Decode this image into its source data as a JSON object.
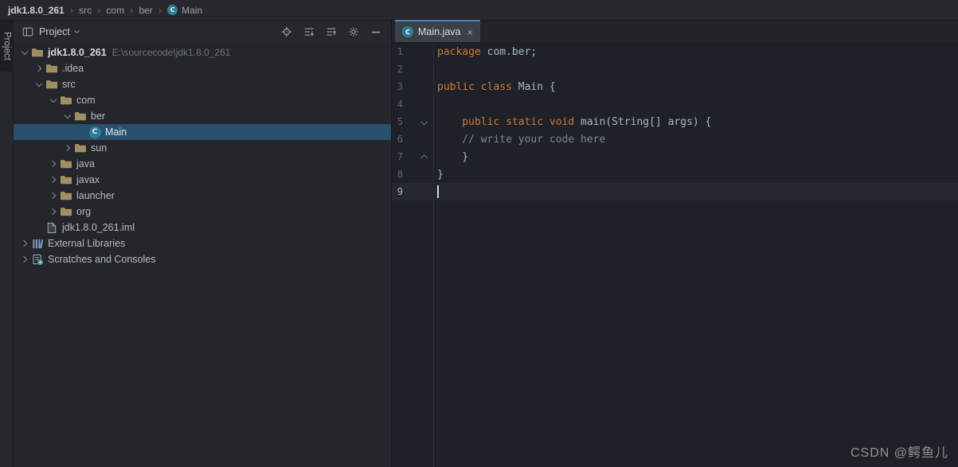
{
  "breadcrumbs": {
    "project": "jdk1.8.0_261",
    "sep": "›",
    "items": [
      "src",
      "com",
      "ber"
    ],
    "class_name": "Main"
  },
  "stripe": {
    "label": "Project"
  },
  "panel": {
    "title": "Project",
    "icons": [
      "locate-file-icon",
      "expand-all-icon",
      "collapse-all-icon",
      "settings-icon",
      "hide-icon"
    ]
  },
  "tree": {
    "items": [
      {
        "label": "jdk1.8.0_261",
        "path": "E:\\sourcecode\\jdk1.8.0_261"
      },
      {
        "label": ".idea"
      },
      {
        "label": "src"
      },
      {
        "label": "com"
      },
      {
        "label": "ber"
      },
      {
        "label": "Main"
      },
      {
        "label": "sun"
      },
      {
        "label": "java"
      },
      {
        "label": "javax"
      },
      {
        "label": "launcher"
      },
      {
        "label": "org"
      },
      {
        "label": "jdk1.8.0_261.iml"
      },
      {
        "label": "External Libraries"
      },
      {
        "label": "Scratches and Consoles"
      }
    ]
  },
  "tab": {
    "label": "Main.java",
    "close": "×"
  },
  "editor": {
    "lines": [
      {
        "num": "1",
        "segments": {
          "kw": "package",
          "pl": " com.ber;"
        }
      },
      {
        "num": "2"
      },
      {
        "num": "3",
        "segments": {
          "kw": "public class",
          "pl": " Main {"
        }
      },
      {
        "num": "4"
      },
      {
        "num": "5",
        "segments": {
          "kw": "    public static void",
          "pl": " main(String[] args) {"
        }
      },
      {
        "num": "6",
        "segments": {
          "cm": "    // write your code here"
        }
      },
      {
        "num": "7",
        "segments": {
          "pl": "    }"
        }
      },
      {
        "num": "8",
        "segments": {
          "pl": "}"
        }
      },
      {
        "num": "9"
      }
    ]
  },
  "icons": {
    "class_letter": "C"
  },
  "watermark": "CSDN @鳄鱼儿",
  "colors": {
    "accent": "#3E86C7",
    "keyword": "#CC7832",
    "comment": "#7F8690",
    "selection": "#2A5070",
    "class_icon": "#2E7F95",
    "editor_bg": "#1E2127",
    "panel_bg": "#24262C"
  }
}
